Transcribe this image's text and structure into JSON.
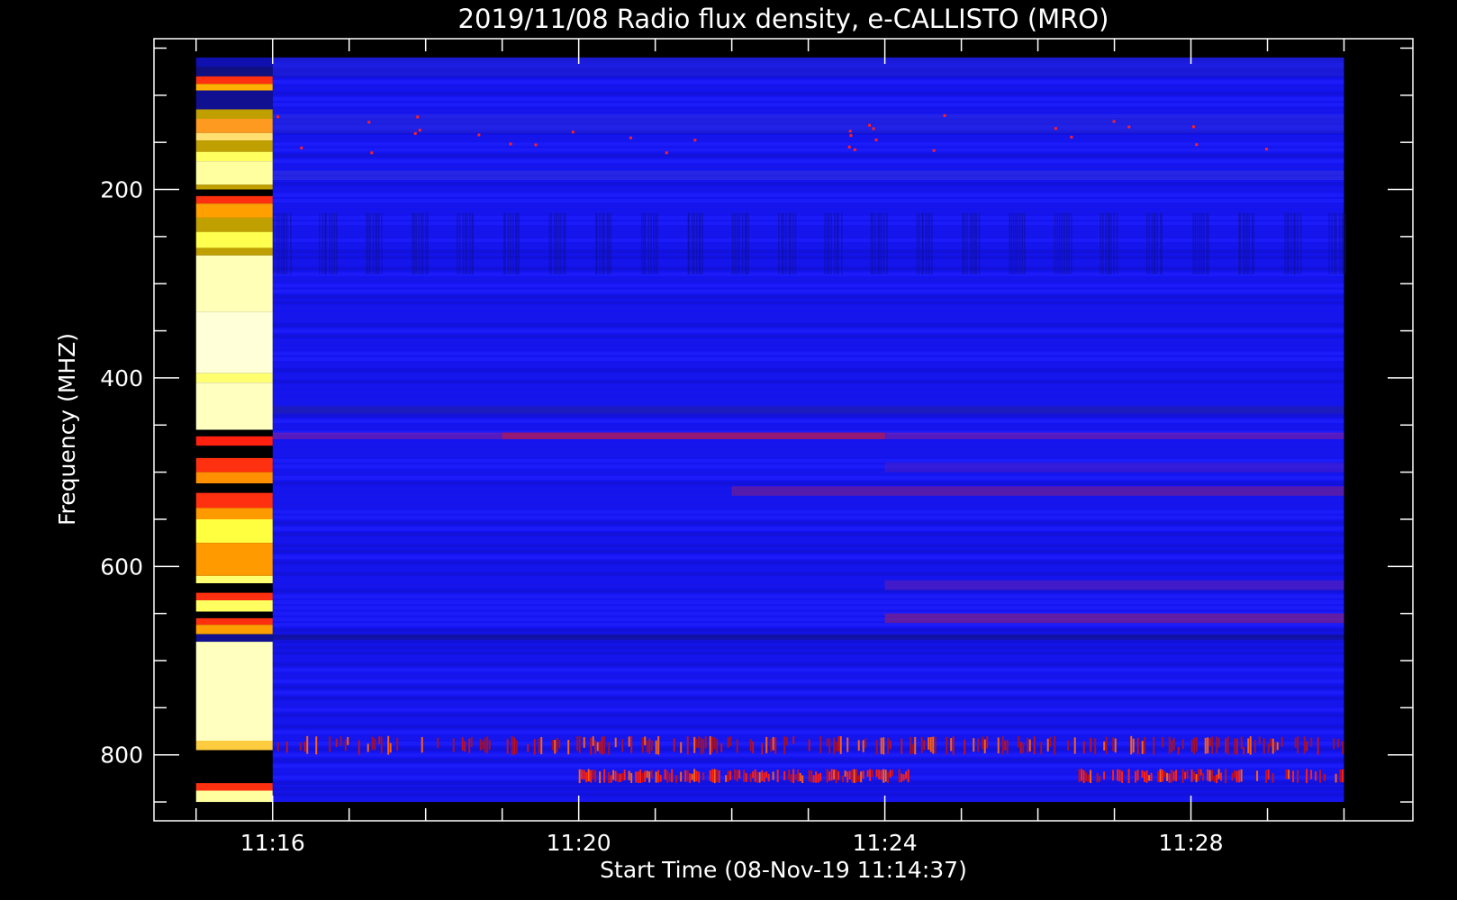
{
  "chart_data": {
    "type": "heatmap",
    "title": "2019/11/08  Radio flux density, e-CALLISTO (MRO)",
    "xlabel": "Start Time (08-Nov-19 11:14:37)",
    "ylabel": "Frequency (MHZ)",
    "x_range": [
      "11:14:37",
      "11:30:00"
    ],
    "xlim_minutes": [
      -1.55,
      14.9
    ],
    "ylim": [
      870,
      40
    ],
    "data_extent_x": [
      "11:15:00",
      "11:30:00"
    ],
    "data_extent_y": [
      60,
      850
    ],
    "x_ticks": [
      {
        "value": "11:16",
        "minute": 0
      },
      {
        "value": "11:20",
        "minute": 4
      },
      {
        "value": "11:24",
        "minute": 8
      },
      {
        "value": "11:28",
        "minute": 12
      }
    ],
    "y_ticks": [
      200,
      400,
      600,
      800
    ],
    "colormap": [
      "#000000",
      "#1a1aa8",
      "#1414f0",
      "#6020b0",
      "#c01010",
      "#ff2020",
      "#ff9000",
      "#ffff40",
      "#ffffd0"
    ],
    "calibration_column": {
      "time_range": [
        "11:15:00",
        "11:16:00"
      ],
      "bands": [
        {
          "from": 60,
          "to": 70,
          "color": "#1010b0"
        },
        {
          "from": 70,
          "to": 80,
          "color": "#101080"
        },
        {
          "from": 80,
          "to": 88,
          "color": "#ff3010"
        },
        {
          "from": 88,
          "to": 95,
          "color": "#ffb000"
        },
        {
          "from": 95,
          "to": 115,
          "color": "#101090"
        },
        {
          "from": 115,
          "to": 125,
          "color": "#c0a000"
        },
        {
          "from": 125,
          "to": 140,
          "color": "#ff9a20"
        },
        {
          "from": 140,
          "to": 148,
          "color": "#ffe070"
        },
        {
          "from": 148,
          "to": 160,
          "color": "#c0a000"
        },
        {
          "from": 160,
          "to": 170,
          "color": "#ffff60"
        },
        {
          "from": 170,
          "to": 195,
          "color": "#ffffa0"
        },
        {
          "from": 195,
          "to": 200,
          "color": "#c0a000"
        },
        {
          "from": 200,
          "to": 207,
          "color": "#000000"
        },
        {
          "from": 207,
          "to": 215,
          "color": "#ff3010"
        },
        {
          "from": 215,
          "to": 230,
          "color": "#ffa000"
        },
        {
          "from": 230,
          "to": 245,
          "color": "#c0a000"
        },
        {
          "from": 245,
          "to": 262,
          "color": "#ffff50"
        },
        {
          "from": 262,
          "to": 270,
          "color": "#c0a000"
        },
        {
          "from": 270,
          "to": 330,
          "color": "#ffffb8"
        },
        {
          "from": 330,
          "to": 395,
          "color": "#ffffd8"
        },
        {
          "from": 395,
          "to": 405,
          "color": "#ffff70"
        },
        {
          "from": 405,
          "to": 455,
          "color": "#ffffc0"
        },
        {
          "from": 455,
          "to": 462,
          "color": "#000000"
        },
        {
          "from": 462,
          "to": 472,
          "color": "#ff2010"
        },
        {
          "from": 472,
          "to": 485,
          "color": "#000000"
        },
        {
          "from": 485,
          "to": 500,
          "color": "#ff3010"
        },
        {
          "from": 500,
          "to": 512,
          "color": "#ff9000"
        },
        {
          "from": 512,
          "to": 522,
          "color": "#000000"
        },
        {
          "from": 522,
          "to": 538,
          "color": "#ff3010"
        },
        {
          "from": 538,
          "to": 550,
          "color": "#ff9a00"
        },
        {
          "from": 550,
          "to": 575,
          "color": "#ffff40"
        },
        {
          "from": 575,
          "to": 610,
          "color": "#ff9a00"
        },
        {
          "from": 610,
          "to": 618,
          "color": "#ffff70"
        },
        {
          "from": 618,
          "to": 628,
          "color": "#000000"
        },
        {
          "from": 628,
          "to": 636,
          "color": "#ff3010"
        },
        {
          "from": 636,
          "to": 648,
          "color": "#ffff60"
        },
        {
          "from": 648,
          "to": 655,
          "color": "#000000"
        },
        {
          "from": 655,
          "to": 662,
          "color": "#ff3010"
        },
        {
          "from": 662,
          "to": 672,
          "color": "#ffa000"
        },
        {
          "from": 672,
          "to": 680,
          "color": "#101090"
        },
        {
          "from": 680,
          "to": 785,
          "color": "#ffffc0"
        },
        {
          "from": 785,
          "to": 795,
          "color": "#ffcc40"
        },
        {
          "from": 795,
          "to": 830,
          "color": "#000000"
        },
        {
          "from": 830,
          "to": 838,
          "color": "#ff3010"
        },
        {
          "from": 838,
          "to": 850,
          "color": "#ffffa0"
        }
      ]
    },
    "background_color": "#1414f0",
    "frequency_features": [
      {
        "from": 60,
        "to": 80,
        "color": "#2020d0",
        "intensity": 0.6,
        "time_range_min": [
          0,
          14
        ]
      },
      {
        "from": 120,
        "to": 140,
        "color": "#3030d0",
        "intensity": 0.4,
        "time_range_min": [
          0,
          14
        ]
      },
      {
        "from": 180,
        "to": 190,
        "color": "#3030d0",
        "intensity": 0.5,
        "time_range_min": [
          0,
          14
        ]
      },
      {
        "from": 225,
        "to": 290,
        "color": "#101090",
        "intensity": 0.5,
        "time_range_min": [
          0,
          14
        ]
      },
      {
        "from": 430,
        "to": 438,
        "color": "#2020a0",
        "intensity": 0.6,
        "time_range_min": [
          0,
          14
        ]
      },
      {
        "from": 458,
        "to": 465,
        "color": "#c01020",
        "intensity": 0.9,
        "time_range_min": [
          3,
          8
        ]
      },
      {
        "from": 458,
        "to": 465,
        "color": "#8020a0",
        "intensity": 0.6,
        "time_range_min": [
          0,
          14
        ]
      },
      {
        "from": 490,
        "to": 500,
        "color": "#6020b0",
        "intensity": 0.4,
        "time_range_min": [
          8,
          14
        ]
      },
      {
        "from": 515,
        "to": 525,
        "color": "#802080",
        "intensity": 0.6,
        "time_range_min": [
          6,
          14
        ]
      },
      {
        "from": 615,
        "to": 625,
        "color": "#6020b0",
        "intensity": 0.6,
        "time_range_min": [
          8,
          14
        ]
      },
      {
        "from": 650,
        "to": 660,
        "color": "#802080",
        "intensity": 0.7,
        "time_range_min": [
          8,
          14
        ]
      },
      {
        "from": 672,
        "to": 678,
        "color": "#101080",
        "intensity": 0.6,
        "time_range_min": [
          0,
          14
        ]
      },
      {
        "from": 780,
        "to": 800,
        "color": "#a01030",
        "intensity": 0.6,
        "time_range_min": [
          0,
          14
        ]
      },
      {
        "from": 815,
        "to": 830,
        "color": "#ff2010",
        "intensity": 1.0,
        "time_range_min": [
          4,
          8.3
        ]
      },
      {
        "from": 815,
        "to": 830,
        "color": "#ff2010",
        "intensity": 0.8,
        "time_range_min": [
          10.5,
          14
        ]
      }
    ]
  }
}
